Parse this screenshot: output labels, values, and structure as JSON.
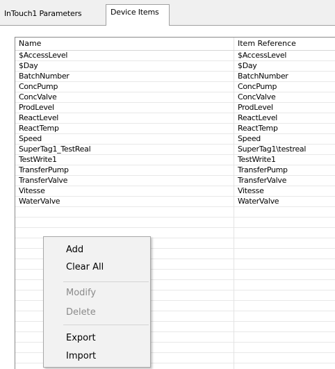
{
  "tabs": [
    {
      "label": "InTouch1 Parameters",
      "active": false
    },
    {
      "label": "Device Items",
      "active": true
    }
  ],
  "list": {
    "columns": [
      "Name",
      "Item Reference"
    ],
    "rows": [
      {
        "name": "$AccessLevel",
        "ref": "$AccessLevel"
      },
      {
        "name": "$Day",
        "ref": "$Day"
      },
      {
        "name": "BatchNumber",
        "ref": "BatchNumber"
      },
      {
        "name": "ConcPump",
        "ref": "ConcPump"
      },
      {
        "name": "ConcValve",
        "ref": "ConcValve"
      },
      {
        "name": "ProdLevel",
        "ref": "ProdLevel"
      },
      {
        "name": "ReactLevel",
        "ref": "ReactLevel"
      },
      {
        "name": "ReactTemp",
        "ref": "ReactTemp"
      },
      {
        "name": "Speed",
        "ref": "Speed"
      },
      {
        "name": "SuperTag1_TestReal",
        "ref": "SuperTag1\\testreal"
      },
      {
        "name": "TestWrite1",
        "ref": "TestWrite1"
      },
      {
        "name": "TransferPump",
        "ref": "TransferPump"
      },
      {
        "name": "TransferValve",
        "ref": "TransferValve"
      },
      {
        "name": "Vitesse",
        "ref": "Vitesse"
      },
      {
        "name": "WaterValve",
        "ref": "WaterValve"
      }
    ]
  },
  "context_menu": {
    "items": [
      {
        "label": "Add",
        "enabled": true
      },
      {
        "label": "Clear All",
        "enabled": true
      },
      {
        "label": "Modify",
        "enabled": false
      },
      {
        "label": "Delete",
        "enabled": false
      },
      {
        "label": "Export",
        "enabled": true
      },
      {
        "label": "Import",
        "enabled": true
      }
    ]
  },
  "colors": {
    "window_bg": "#f0f0f0",
    "list_bg": "#ffffff",
    "menu_bg": "#f2f2f2",
    "disabled_text": "#8a8a8a"
  }
}
